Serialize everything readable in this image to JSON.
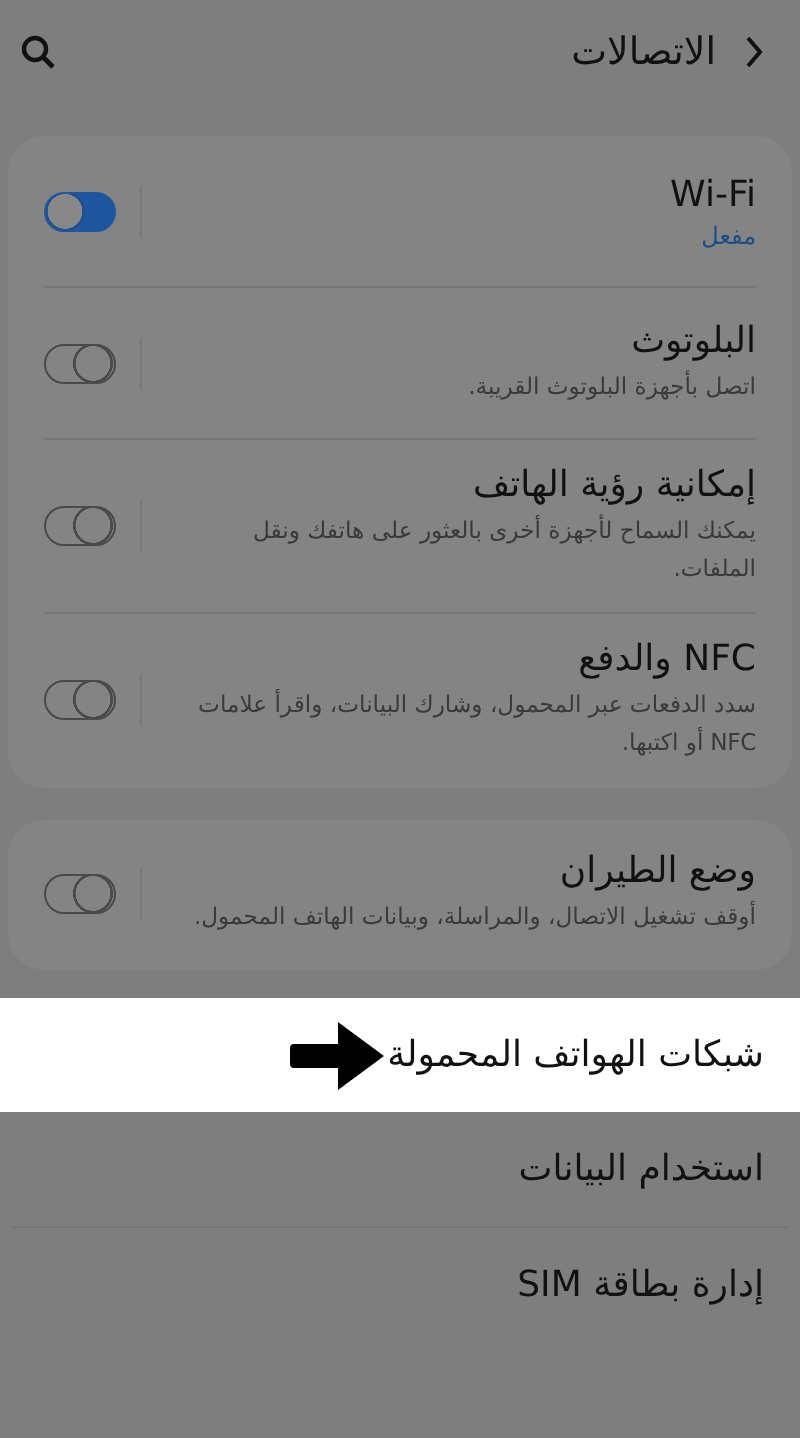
{
  "header": {
    "title": "الاتصالات"
  },
  "groups": [
    {
      "items": [
        {
          "kind": "toggle",
          "title": "Wi-Fi",
          "status": "مفعل",
          "on": true
        },
        {
          "kind": "toggle",
          "title": "البلوتوث",
          "description": "اتصل بأجهزة البلوتوث القريبة.",
          "on": false
        },
        {
          "kind": "toggle",
          "title": "إمكانية رؤية الهاتف",
          "description": "يمكنك السماح لأجهزة أخرى بالعثور على هاتفك ونقل الملفات.",
          "on": false
        },
        {
          "kind": "toggle",
          "title": "NFC والدفع",
          "description": "سدد الدفعات عبر المحمول، وشارك البيانات، واقرأ علامات NFC أو اكتبها.",
          "on": false
        }
      ]
    },
    {
      "items": [
        {
          "kind": "toggle",
          "title": "وضع الطيران",
          "description": "أوقف تشغيل الاتصال، والمراسلة، وبيانات الهاتف المحمول.",
          "on": false
        }
      ]
    },
    {
      "items": [
        {
          "kind": "link",
          "title": "شبكات الهواتف المحمولة",
          "highlighted": true
        },
        {
          "kind": "link",
          "title": "استخدام البيانات",
          "highlighted": false
        },
        {
          "kind": "link",
          "title": "إدارة بطاقة SIM",
          "highlighted": false
        }
      ]
    }
  ]
}
